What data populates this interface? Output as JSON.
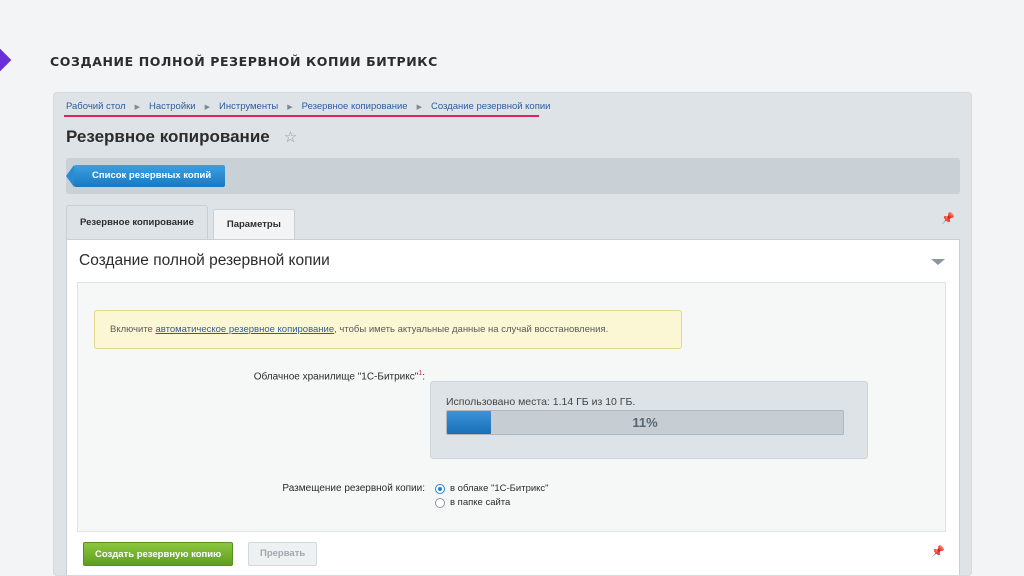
{
  "slide": {
    "title": "СОЗДАНИЕ ПОЛНОЙ РЕЗЕРВНОЙ КОПИИ БИТРИКС",
    "accent_color": "#6a2fd6"
  },
  "breadcrumb": {
    "items": [
      "Рабочий стол",
      "Настройки",
      "Инструменты",
      "Резервное копирование",
      "Создание резервной копии"
    ],
    "separator_icon": "triangle-right-icon",
    "highlight_color": "#e0245e"
  },
  "page": {
    "title": "Резервное копирование",
    "favorite_icon": "star-icon"
  },
  "toolbar": {
    "list_button_label": "Список резервных копий"
  },
  "tabs": [
    {
      "label": "Резервное копирование",
      "active": true
    },
    {
      "label": "Параметры",
      "active": false
    }
  ],
  "panel": {
    "title": "Создание полной резервной копии",
    "notice": {
      "prefix": "Включите ",
      "link": "автоматическое резервное копирование",
      "suffix": ", чтобы иметь актуальные данные на случай восстановления."
    },
    "cloud_label": "Облачное хранилище \"1С-Битрикс\"",
    "cloud_label_sup": "1",
    "cloud_label_colon": ":",
    "storage_text": "Использовано места: 1.14 ГБ из 10 ГБ.",
    "progress": {
      "percent": 11,
      "label": "11%"
    },
    "placement_label": "Размещение резервной копии:",
    "placement_options": [
      {
        "label": "в облаке \"1С-Битрикс\"",
        "checked": true
      },
      {
        "label": "в папке сайта",
        "checked": false
      }
    ]
  },
  "actions": {
    "create_label": "Создать резервную копию",
    "abort_label": "Прервать"
  }
}
